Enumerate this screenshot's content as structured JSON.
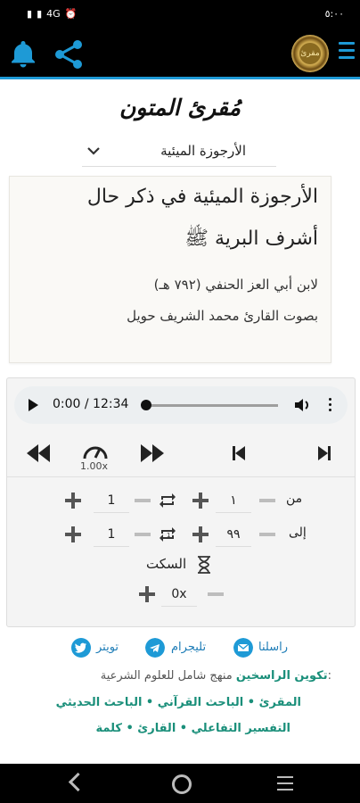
{
  "status": {
    "left": "4G",
    "right": "٥:٠٠"
  },
  "app": {
    "title": "مُقرئ المتون",
    "logo_text": "مقرئ"
  },
  "selector": {
    "value": "الأرجوزة الميئية"
  },
  "card": {
    "line1": "الأرجوزة الميئية في ذكر حال",
    "line2": "أشرف البرية ﷺ",
    "line3": "لابن أبي العز الحنفي (٧٩٢ هـ)",
    "line4": "بصوت القارئ محمد الشريف حويل"
  },
  "player": {
    "time": "0:00 / 12:34",
    "speed": "1.00x",
    "from_label": "من",
    "to_label": "إلى",
    "from_repeat": "1",
    "from_value": "١",
    "to_repeat": "1",
    "to_value": "٩٩",
    "silence_label": "السكت",
    "silence_value": "0x",
    "progress": 0.0
  },
  "footer": {
    "contact": "راسلنا",
    "telegram": "تليجرام",
    "twitter": "تويتر",
    "desc_prefix": "منهج شامل للعلوم الشرعية:",
    "desc_link": "تكوين الراسخين",
    "row1": "المقرئ • الباحث القرآني • الباحث الحديثي",
    "row2": "التفسير التفاعلي • القارئ • كلمة"
  },
  "colors": {
    "accent": "#1e9ad6",
    "teal": "#1a8f7a",
    "link": "#1e7db7"
  }
}
